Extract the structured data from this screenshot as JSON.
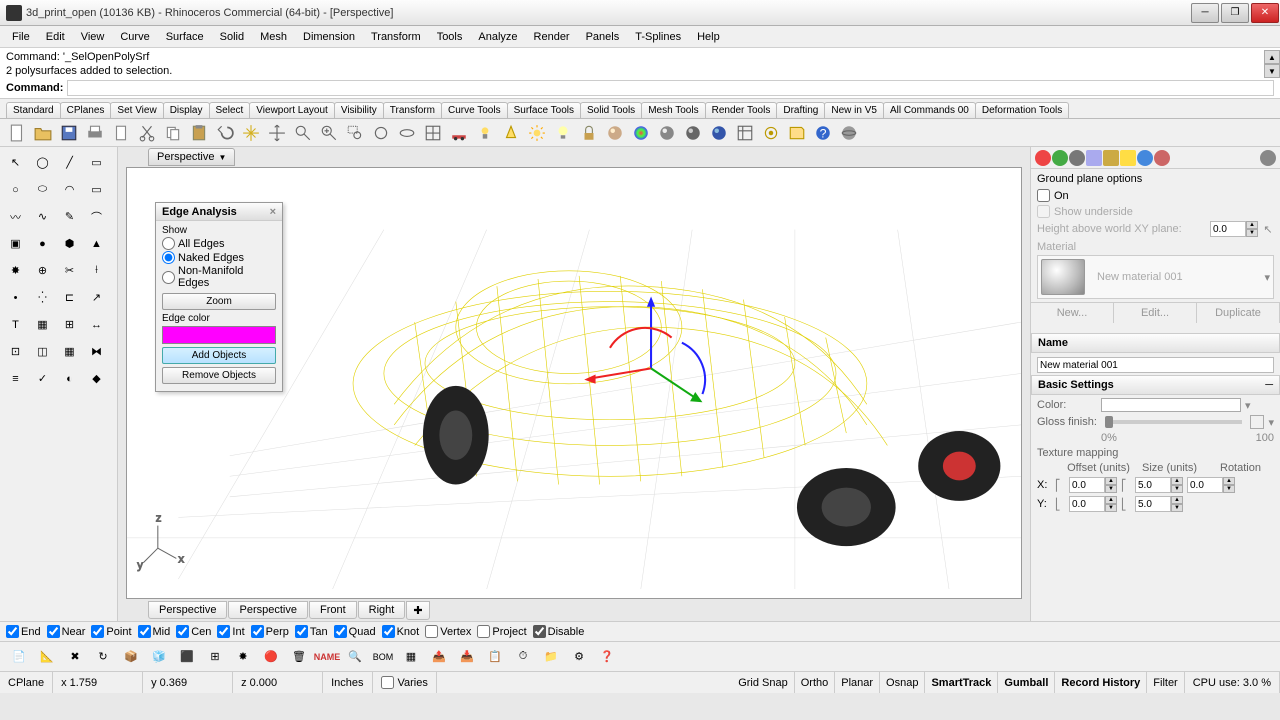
{
  "title": "3d_print_open (10136 KB) - Rhinoceros Commercial (64-bit) - [Perspective]",
  "menu": [
    "File",
    "Edit",
    "View",
    "Curve",
    "Surface",
    "Solid",
    "Mesh",
    "Dimension",
    "Transform",
    "Tools",
    "Analyze",
    "Render",
    "Panels",
    "T-Splines",
    "Help"
  ],
  "cmd_history": [
    "Command: '_SelOpenPolySrf",
    "2 polysurfaces added to selection."
  ],
  "cmd_label": "Command:",
  "tabs": [
    "Standard",
    "CPlanes",
    "Set View",
    "Display",
    "Select",
    "Viewport Layout",
    "Visibility",
    "Transform",
    "Curve Tools",
    "Surface Tools",
    "Solid Tools",
    "Mesh Tools",
    "Render Tools",
    "Drafting",
    "New in V5",
    "All Commands 00",
    "Deformation Tools"
  ],
  "viewport_name": "Perspective",
  "bottom_tabs": [
    "Perspective",
    "Perspective",
    "Front",
    "Right"
  ],
  "edge_panel": {
    "title": "Edge Analysis",
    "show_label": "Show",
    "opt_all": "All Edges",
    "opt_naked": "Naked Edges",
    "opt_nonman": "Non-Manifold Edges",
    "zoom": "Zoom",
    "edge_color_label": "Edge color",
    "edge_color": "#ff00ff",
    "add": "Add Objects",
    "remove": "Remove Objects"
  },
  "right": {
    "ground_title": "Ground plane options",
    "on": "On",
    "underside": "Show underside",
    "height_label": "Height above world XY plane:",
    "height_val": "0.0",
    "material_label": "Material",
    "material_name": "New material 001",
    "new": "New...",
    "edit": "Edit...",
    "dup": "Duplicate",
    "name_label": "Name",
    "name_val": "New material 001",
    "basic_label": "Basic Settings",
    "color_label": "Color:",
    "gloss_label": "Gloss finish:",
    "tex_label": "Texture mapping",
    "offset": "Offset (units)",
    "size": "Size (units)",
    "rot": "Rotation",
    "x": "X:",
    "y": "Y:",
    "off_x": "0.0",
    "off_y": "0.0",
    "size_x": "5.0",
    "size_y": "5.0",
    "rot_x": "0.0",
    "gloss_min": "0%",
    "gloss_max": "100"
  },
  "osnap": {
    "items": [
      "End",
      "Near",
      "Point",
      "Mid",
      "Cen",
      "Int",
      "Perp",
      "Tan",
      "Quad",
      "Knot",
      "Vertex",
      "Project",
      "Disable"
    ]
  },
  "status": {
    "cplane": "CPlane",
    "x": "x 1.759",
    "y": "y 0.369",
    "z": "z 0.000",
    "units": "Inches",
    "varies": "Varies",
    "toggles": [
      "Grid Snap",
      "Ortho",
      "Planar",
      "Osnap",
      "SmartTrack",
      "Gumball",
      "Record History",
      "Filter"
    ],
    "cpu": "CPU use: 3.0 %"
  }
}
